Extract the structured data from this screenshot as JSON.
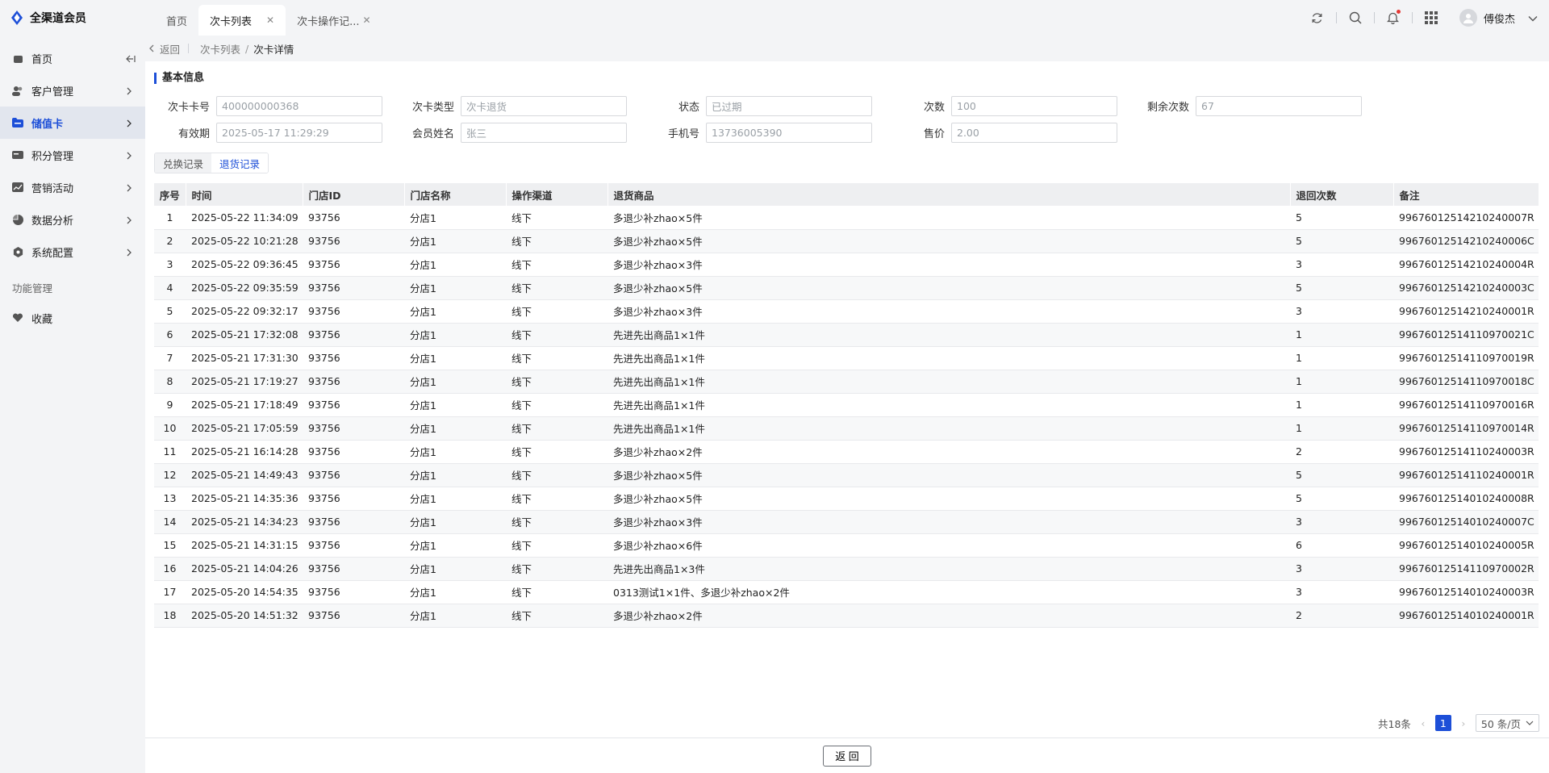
{
  "app": {
    "name": "全渠道会员"
  },
  "sidebar": {
    "items": [
      {
        "label": "首页"
      },
      {
        "label": "客户管理"
      },
      {
        "label": "储值卡"
      },
      {
        "label": "积分管理"
      },
      {
        "label": "营销活动"
      },
      {
        "label": "数据分析"
      },
      {
        "label": "系统配置"
      }
    ],
    "group_title": "功能管理",
    "favorites": "收藏"
  },
  "tabs": [
    {
      "label": "首页"
    },
    {
      "label": "次卡列表"
    },
    {
      "label": "次卡操作记..."
    }
  ],
  "user": {
    "name": "傅俊杰"
  },
  "breadcrumb": {
    "back": "返回",
    "parent": "次卡列表",
    "current": "次卡详情"
  },
  "basic_info": {
    "title": "基本信息",
    "fields": [
      {
        "label": "次卡卡号",
        "value": "400000000368"
      },
      {
        "label": "次卡类型",
        "value": "次卡退货"
      },
      {
        "label": "状态",
        "value": "已过期"
      },
      {
        "label": "次数",
        "value": "100"
      },
      {
        "label": "剩余次数",
        "value": "67"
      },
      {
        "label": "有效期",
        "value": "2025-05-17 11:29:29"
      },
      {
        "label": "会员姓名",
        "value": "张三"
      },
      {
        "label": "手机号",
        "value": "13736005390"
      },
      {
        "label": "售价",
        "value": "2.00"
      }
    ]
  },
  "subtabs": [
    {
      "label": "兑换记录"
    },
    {
      "label": "退货记录"
    }
  ],
  "table": {
    "headers": [
      "序号",
      "时间",
      "门店ID",
      "门店名称",
      "操作渠道",
      "退货商品",
      "退回次数",
      "备注"
    ],
    "rows": [
      [
        "1",
        "2025-05-22 11:34:09",
        "93756",
        "分店1",
        "线下",
        "多退少补zhao×5件",
        "5",
        "99676012514210240007R"
      ],
      [
        "2",
        "2025-05-22 10:21:28",
        "93756",
        "分店1",
        "线下",
        "多退少补zhao×5件",
        "5",
        "99676012514210240006C"
      ],
      [
        "3",
        "2025-05-22 09:36:45",
        "93756",
        "分店1",
        "线下",
        "多退少补zhao×3件",
        "3",
        "99676012514210240004R"
      ],
      [
        "4",
        "2025-05-22 09:35:59",
        "93756",
        "分店1",
        "线下",
        "多退少补zhao×5件",
        "5",
        "99676012514210240003C"
      ],
      [
        "5",
        "2025-05-22 09:32:17",
        "93756",
        "分店1",
        "线下",
        "多退少补zhao×3件",
        "3",
        "99676012514210240001R"
      ],
      [
        "6",
        "2025-05-21 17:32:08",
        "93756",
        "分店1",
        "线下",
        "先进先出商品1×1件",
        "1",
        "99676012514110970021C"
      ],
      [
        "7",
        "2025-05-21 17:31:30",
        "93756",
        "分店1",
        "线下",
        "先进先出商品1×1件",
        "1",
        "99676012514110970019R"
      ],
      [
        "8",
        "2025-05-21 17:19:27",
        "93756",
        "分店1",
        "线下",
        "先进先出商品1×1件",
        "1",
        "99676012514110970018C"
      ],
      [
        "9",
        "2025-05-21 17:18:49",
        "93756",
        "分店1",
        "线下",
        "先进先出商品1×1件",
        "1",
        "99676012514110970016R"
      ],
      [
        "10",
        "2025-05-21 17:05:59",
        "93756",
        "分店1",
        "线下",
        "先进先出商品1×1件",
        "1",
        "99676012514110970014R"
      ],
      [
        "11",
        "2025-05-21 16:14:28",
        "93756",
        "分店1",
        "线下",
        "多退少补zhao×2件",
        "2",
        "99676012514110240003R"
      ],
      [
        "12",
        "2025-05-21 14:49:43",
        "93756",
        "分店1",
        "线下",
        "多退少补zhao×5件",
        "5",
        "99676012514110240001R"
      ],
      [
        "13",
        "2025-05-21 14:35:36",
        "93756",
        "分店1",
        "线下",
        "多退少补zhao×5件",
        "5",
        "99676012514010240008R"
      ],
      [
        "14",
        "2025-05-21 14:34:23",
        "93756",
        "分店1",
        "线下",
        "多退少补zhao×3件",
        "3",
        "99676012514010240007C"
      ],
      [
        "15",
        "2025-05-21 14:31:15",
        "93756",
        "分店1",
        "线下",
        "多退少补zhao×6件",
        "6",
        "99676012514010240005R"
      ],
      [
        "16",
        "2025-05-21 14:04:26",
        "93756",
        "分店1",
        "线下",
        "先进先出商品1×3件",
        "3",
        "99676012514110970002R"
      ],
      [
        "17",
        "2025-05-20 14:54:35",
        "93756",
        "分店1",
        "线下",
        "0313测试1×1件、多退少补zhao×2件",
        "3",
        "99676012514010240003R"
      ],
      [
        "18",
        "2025-05-20 14:51:32",
        "93756",
        "分店1",
        "线下",
        "多退少补zhao×2件",
        "2",
        "99676012514010240001R"
      ]
    ]
  },
  "pagination": {
    "total": "共18条",
    "current": "1",
    "page_size": "50 条/页"
  },
  "footer": {
    "back_button": "返 回"
  },
  "colors": {
    "accent": "#1d4fd8",
    "sidebar_active_bg": "#e2e6ee",
    "notify_dot": "#e53935"
  }
}
